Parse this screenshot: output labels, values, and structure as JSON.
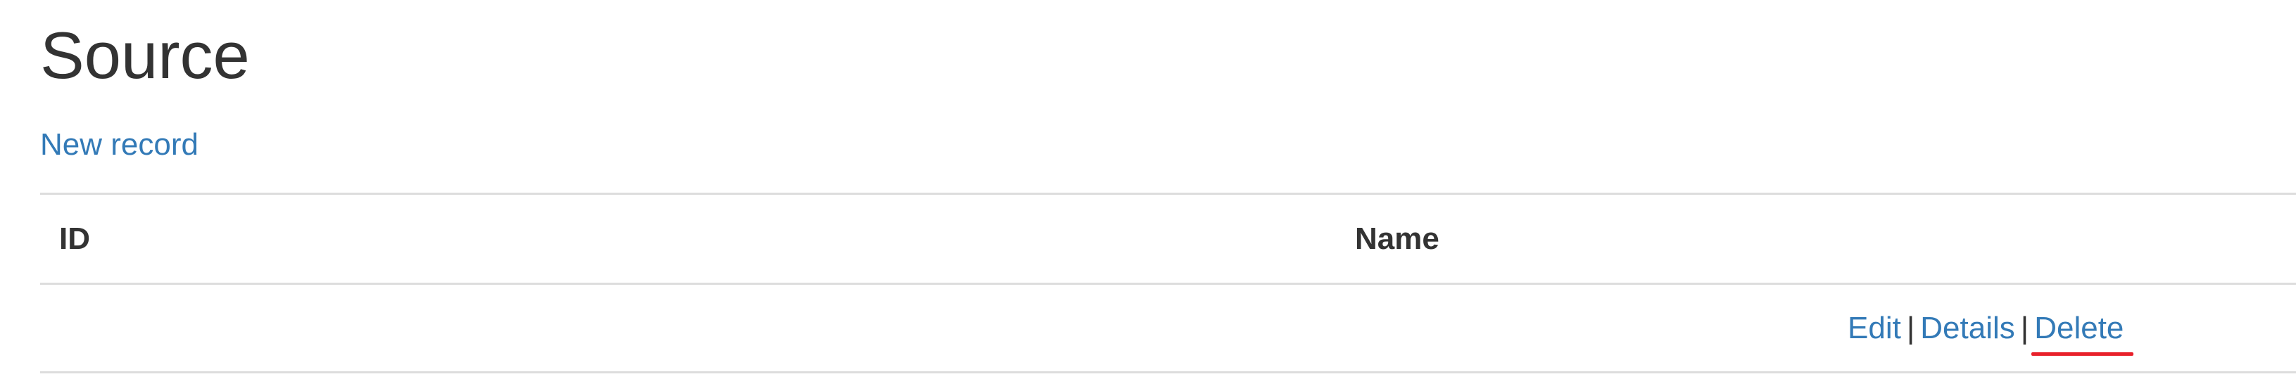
{
  "page": {
    "title": "Source",
    "new_record_label": "New record"
  },
  "table": {
    "columns": [
      "ID",
      "Name",
      ""
    ],
    "rows": [
      {
        "id": "",
        "name": "",
        "actions": {
          "edit_label": "Edit",
          "details_label": "Details",
          "delete_label": "Delete",
          "separator": "|"
        }
      }
    ]
  },
  "colors": {
    "link": "#337ab7",
    "text": "#333333",
    "border": "#dddddd",
    "highlight_underline": "#e8202a"
  }
}
